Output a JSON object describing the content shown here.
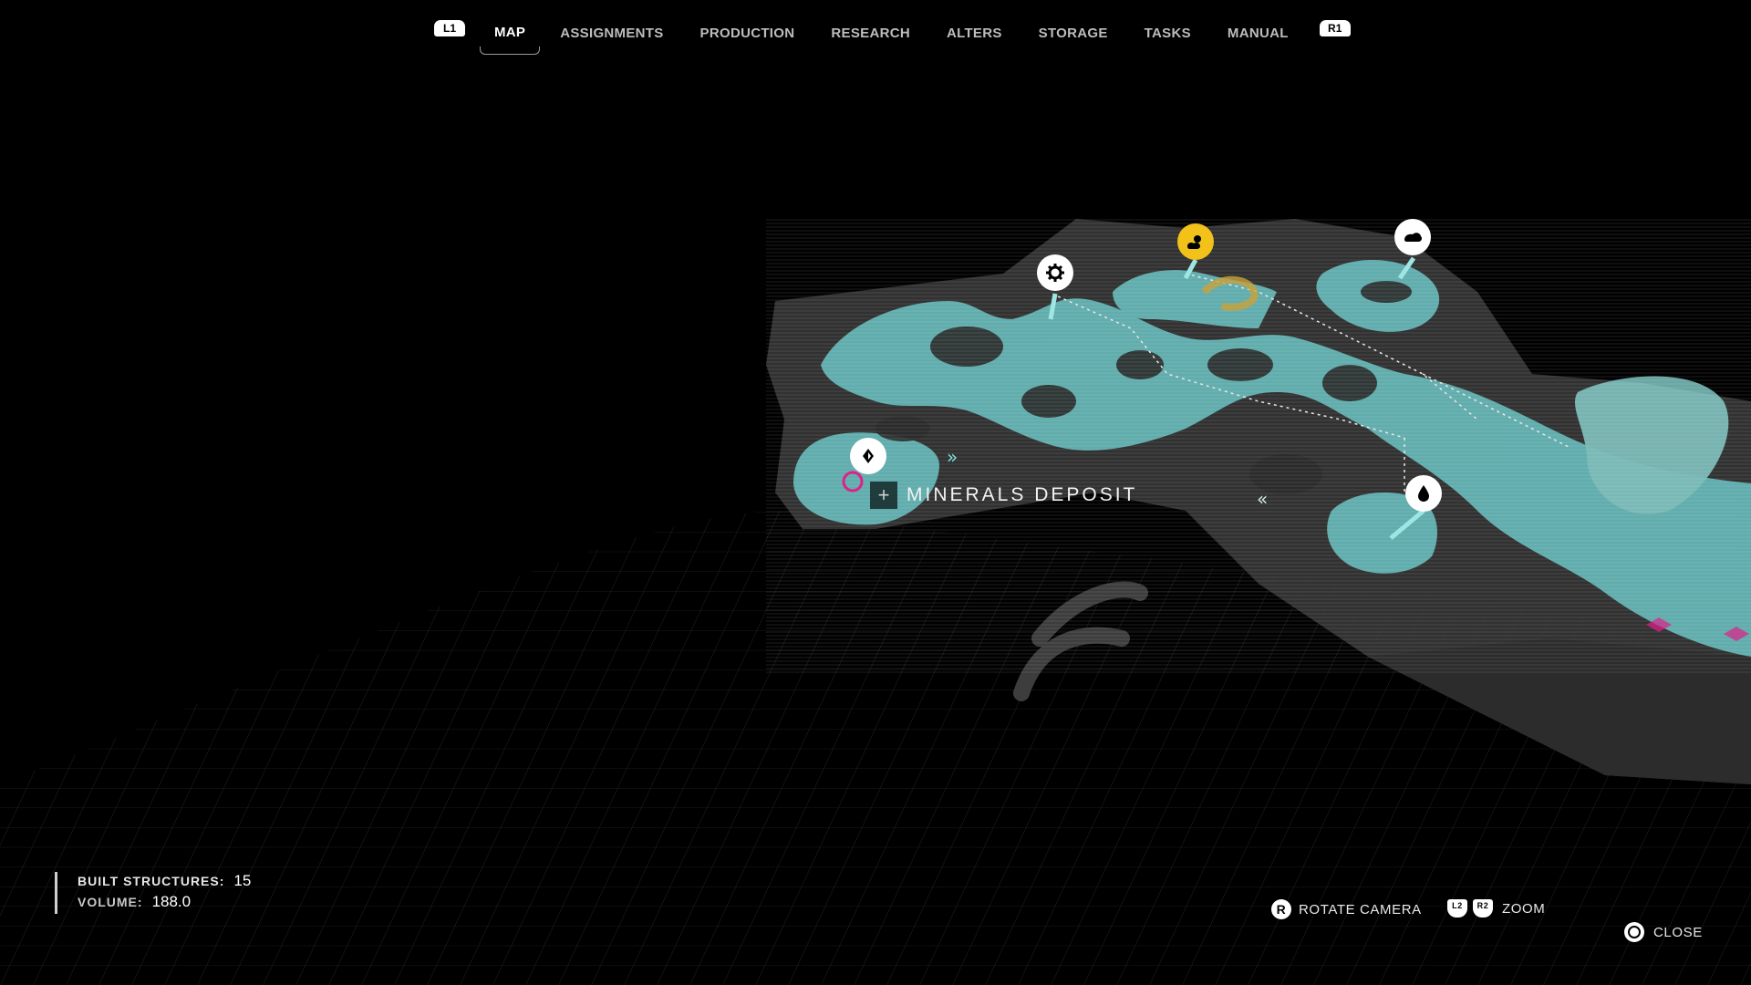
{
  "nav": {
    "left_shoulder": "L1",
    "right_shoulder": "R1",
    "tabs": [
      {
        "label": "MAP",
        "active": true
      },
      {
        "label": "ASSIGNMENTS",
        "active": false
      },
      {
        "label": "PRODUCTION",
        "active": false
      },
      {
        "label": "RESEARCH",
        "active": false
      },
      {
        "label": "ALTERS",
        "active": false
      },
      {
        "label": "STORAGE",
        "active": false
      },
      {
        "label": "TASKS",
        "active": false
      },
      {
        "label": "MANUAL",
        "active": false
      }
    ]
  },
  "map": {
    "selected_label": "MINERALS DEPOSIT",
    "colors": {
      "cave": "#6fcfd0",
      "rock": "#3a3a3a",
      "accent": "#f2c21b",
      "hazard": "#e0208a"
    },
    "pins": [
      {
        "icon": "minerals-diamond-icon"
      },
      {
        "icon": "gear-icon"
      },
      {
        "icon": "sun-cloud-icon"
      },
      {
        "icon": "stone-icon"
      },
      {
        "icon": "water-drop-icon"
      }
    ]
  },
  "stats": {
    "built_structures_label": "BUILT STRUCTURES:",
    "built_structures_value": "15",
    "volume_label": "VOLUME:",
    "volume_value": "188.0"
  },
  "hints": {
    "rotate_button": "R",
    "rotate_label": "ROTATE CAMERA",
    "zoom_left": "L2",
    "zoom_right": "R2",
    "zoom_label": "ZOOM",
    "close_label": "CLOSE"
  }
}
